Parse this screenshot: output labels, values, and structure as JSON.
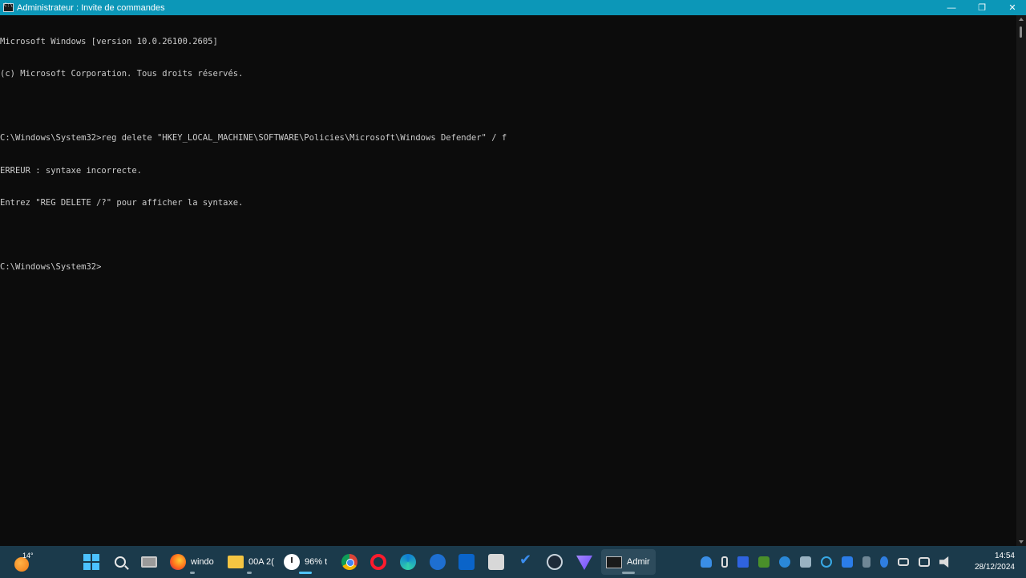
{
  "window": {
    "title": "Administrateur : Invite de commandes",
    "controls": {
      "minimize": "—",
      "restore": "❐",
      "close": "✕"
    }
  },
  "console": {
    "lines": [
      "Microsoft Windows [version 10.0.26100.2605]",
      "(c) Microsoft Corporation. Tous droits réservés.",
      "",
      "C:\\Windows\\System32>reg delete \"HKEY_LOCAL_MACHINE\\SOFTWARE\\Policies\\Microsoft\\Windows Defender\" / f",
      "ERREUR : syntaxe incorrecte.",
      "Entrez \"REG DELETE /?\" pour afficher la syntaxe.",
      "",
      "C:\\Windows\\System32>"
    ]
  },
  "taskbar": {
    "weather": {
      "temp": "14°",
      "icon": "sun-icon"
    },
    "items": {
      "firefox": "windo",
      "explorer": "00A 2(",
      "clock_app": "96% t",
      "cmd": "Admir"
    },
    "datetime": {
      "time": "14:54",
      "date": "28/12/2024"
    }
  },
  "colors": {
    "titlebar": "#0c97b8",
    "console_bg": "#0c0c0c",
    "console_text": "#cccccc",
    "taskbar_bg": "#1b3a4b"
  }
}
